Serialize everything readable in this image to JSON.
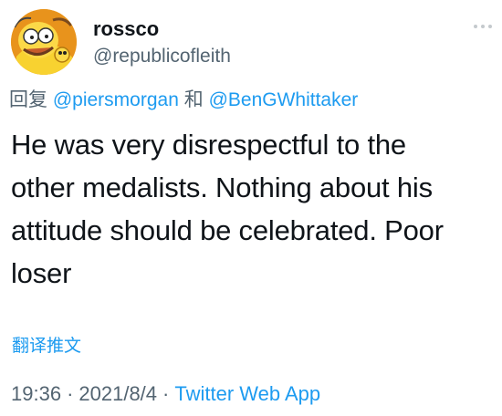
{
  "user": {
    "display_name": "rossco",
    "handle": "@republicofleith",
    "avatar_icon": "cartoon-character-avatar-icon"
  },
  "reply": {
    "prefix": "回复",
    "mention_1": "@piersmorgan",
    "connector": "和",
    "mention_2": "@BenGWhittaker"
  },
  "tweet": {
    "lines": [
      "He was very disrespectful to the",
      "other medalists. Nothing about his",
      "attitude should be celebrated. Poor",
      "loser"
    ]
  },
  "translate_label": "翻译推文",
  "meta": {
    "time": "19:36",
    "separator": "·",
    "date": "2021/8/4",
    "source": "Twitter Web App"
  },
  "colors": {
    "link": "#1d9bf0",
    "secondary": "#536471",
    "primary": "#0f1419"
  }
}
